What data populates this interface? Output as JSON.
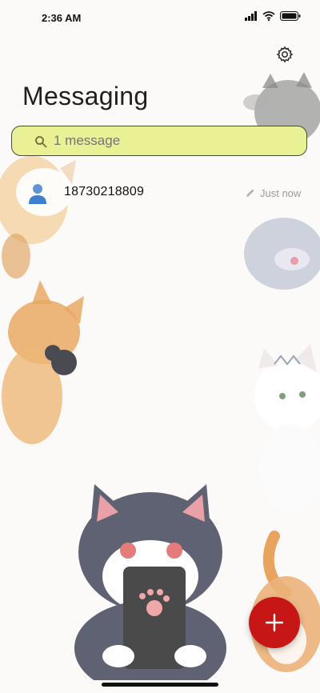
{
  "status_bar": {
    "time": "2:36 AM",
    "icons": [
      "signal-icon",
      "wifi-icon",
      "battery-icon"
    ]
  },
  "header": {
    "title": "Messaging",
    "settings_icon": "gear-icon"
  },
  "search": {
    "placeholder": "1 message",
    "icon": "search-icon",
    "background": "#eaf094"
  },
  "conversations": [
    {
      "contact": "18730218809",
      "time": "Just now",
      "status_icon": "edit-icon"
    }
  ],
  "fab": {
    "icon": "plus-icon",
    "color": "#c61616"
  },
  "theme": {
    "background": "#fcfaf8",
    "wallpaper": "cat-illustration"
  }
}
